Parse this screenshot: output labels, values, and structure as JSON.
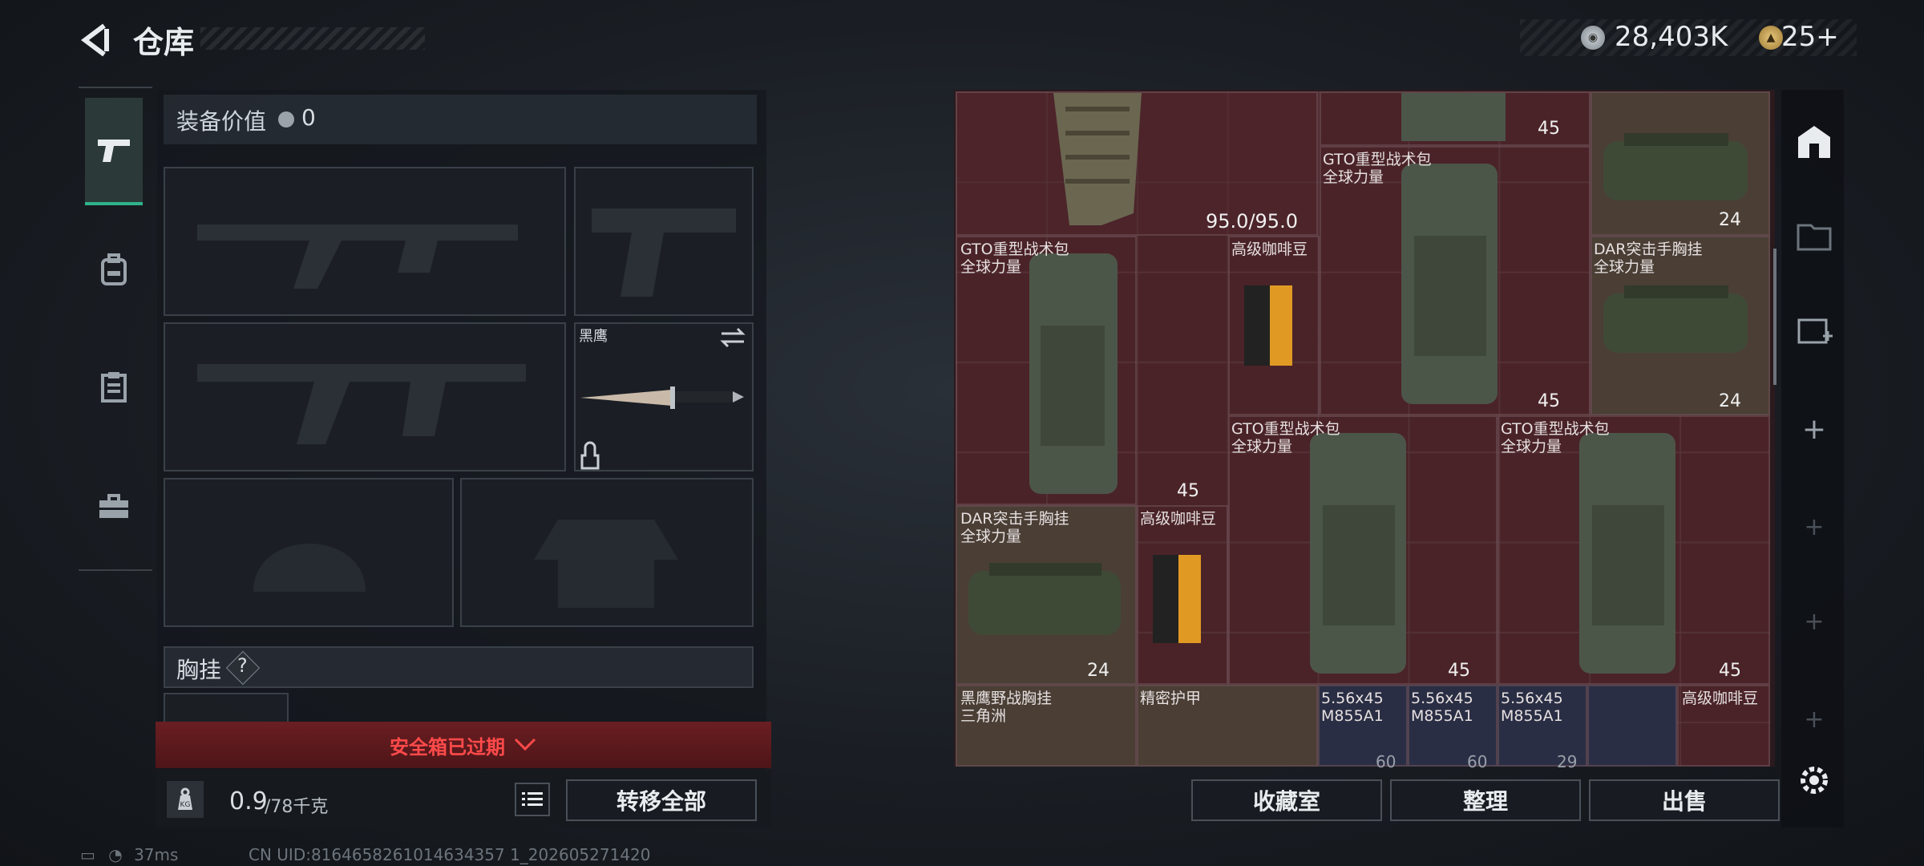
{
  "header": {
    "title": "仓库",
    "currency_value": "28,403K",
    "gold_value": "25+"
  },
  "equipment": {
    "value_label": "装备价值",
    "value": "0",
    "knife_name": "黑鹰",
    "vest_label": "胸挂",
    "vest_help": "?",
    "safebox_text": "安全箱已过期",
    "weight_value": "0.9",
    "weight_max": "/78千克",
    "transfer_label": "转移全部"
  },
  "storage": {
    "items": [
      {
        "name": "",
        "tag": "95.0/95.0"
      },
      {
        "name": "GTO重型战术包\n全球力量",
        "tag": "45"
      },
      {
        "name": "",
        "tag": "45"
      },
      {
        "name": "",
        "tag": "24"
      },
      {
        "name": "GTO重型战术包\n全球力量",
        "tag": "45"
      },
      {
        "name": "高级咖啡豆",
        "tag": ""
      },
      {
        "name": "DAR突击手胸挂\n全球力量",
        "tag": "24"
      },
      {
        "name": "GTO重型战术包\n全球力量",
        "tag": "45"
      },
      {
        "name": "GTO重型战术包\n全球力量",
        "tag": "45"
      },
      {
        "name": "DAR突击手胸挂\n全球力量",
        "tag": "24"
      },
      {
        "name": "高级咖啡豆",
        "tag": ""
      },
      {
        "name": "黑鹰野战胸挂\n三角洲",
        "tag": ""
      },
      {
        "name": "精密护甲",
        "tag": ""
      },
      {
        "name": "5.56x45\nM855A1",
        "tag": "60"
      },
      {
        "name": "5.56x45\nM855A1",
        "tag": "60"
      },
      {
        "name": "5.56x45\nM855A1",
        "tag": "29"
      },
      {
        "name": "高级咖啡豆",
        "tag": ""
      }
    ]
  },
  "actions": {
    "collect": "收藏室",
    "sort": "整理",
    "sell": "出售"
  },
  "status": {
    "ping": "37ms",
    "uid": "CN UID:8164658261014634357 1_202605271420"
  },
  "colors": {
    "accent": "#2fb38a",
    "danger": "#ff4a4a",
    "grid_bg": "#4a2328"
  }
}
